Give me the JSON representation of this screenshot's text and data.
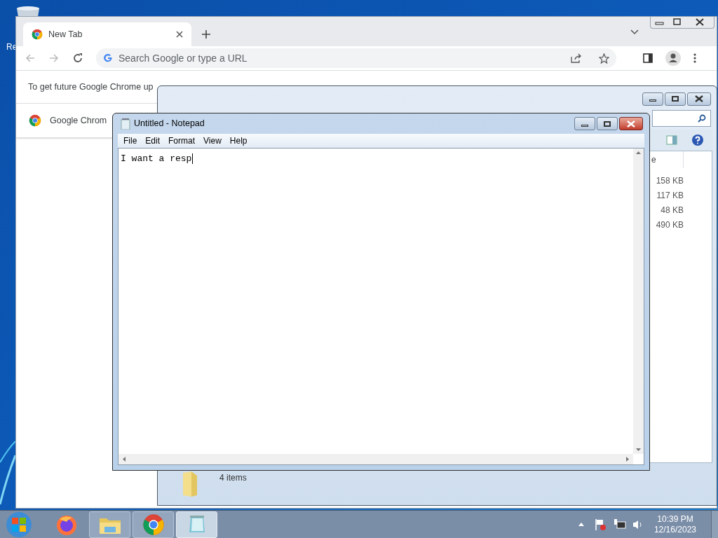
{
  "desktop": {
    "icon_label": "Re"
  },
  "chrome": {
    "tabs": [
      {
        "label": "New Tab",
        "selected": true
      }
    ],
    "omnibox": {
      "placeholder": "Search Google or type a URL"
    },
    "infobar": {
      "message": "To get future Google Chrome up"
    },
    "page": {
      "item": "Google Chrom"
    }
  },
  "explorer": {
    "column_3": "e",
    "sizes": [
      "158 KB",
      "117 KB",
      "48 KB",
      "490 KB"
    ],
    "status": "4 items"
  },
  "notepad": {
    "title": "Untitled - Notepad",
    "menu": [
      "File",
      "Edit",
      "Format",
      "View",
      "Help"
    ],
    "text": "I want a resp"
  },
  "taskbar": {
    "items": [
      {
        "kind": "firefox",
        "running": false,
        "active": false
      },
      {
        "kind": "explorer",
        "running": true,
        "active": false
      },
      {
        "kind": "chrome",
        "running": true,
        "active": false
      },
      {
        "kind": "notepad",
        "running": true,
        "active": true
      }
    ],
    "time": "10:39 PM",
    "date": "12/16/2023"
  }
}
